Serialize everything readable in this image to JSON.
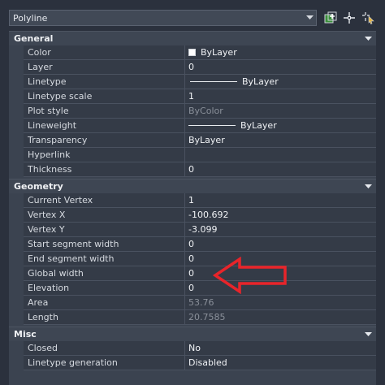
{
  "toolbar": {
    "object_type": "Polyline",
    "icons": [
      "toggle-pickadd-icon",
      "select-objects-icon",
      "quick-select-icon"
    ]
  },
  "sections": {
    "general": {
      "title": "General",
      "rows": [
        {
          "label": "Color",
          "value": "ByLayer"
        },
        {
          "label": "Layer",
          "value": "0"
        },
        {
          "label": "Linetype",
          "value": "ByLayer"
        },
        {
          "label": "Linetype scale",
          "value": "1"
        },
        {
          "label": "Plot style",
          "value": "ByColor"
        },
        {
          "label": "Lineweight",
          "value": "ByLayer"
        },
        {
          "label": "Transparency",
          "value": "ByLayer"
        },
        {
          "label": "Hyperlink",
          "value": ""
        },
        {
          "label": "Thickness",
          "value": "0"
        }
      ]
    },
    "geometry": {
      "title": "Geometry",
      "rows": [
        {
          "label": "Current Vertex",
          "value": "1"
        },
        {
          "label": "Vertex X",
          "value": "-100.692"
        },
        {
          "label": "Vertex Y",
          "value": "-3.099"
        },
        {
          "label": "Start segment width",
          "value": "0"
        },
        {
          "label": "End segment width",
          "value": "0"
        },
        {
          "label": "Global width",
          "value": "0"
        },
        {
          "label": "Elevation",
          "value": "0"
        },
        {
          "label": "Area",
          "value": "53.76"
        },
        {
          "label": "Length",
          "value": "20.7585"
        }
      ]
    },
    "misc": {
      "title": "Misc",
      "rows": [
        {
          "label": "Closed",
          "value": "No"
        },
        {
          "label": "Linetype generation",
          "value": "Disabled"
        }
      ]
    }
  },
  "colors": {
    "background": "#2b313d",
    "row": "#343b47",
    "header": "#3e4653",
    "annotation_arrow": "#e8242a",
    "dim_text": "#8a909a"
  }
}
